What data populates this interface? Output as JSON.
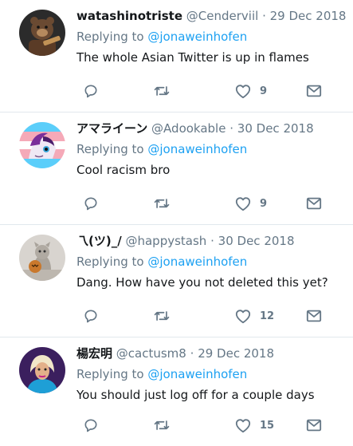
{
  "tweets": [
    {
      "name": "watashinotriste",
      "handle": "@Cenderviil",
      "date": "29 Dec 2018",
      "replying_prefix": "Replying to",
      "replying_to": "@jonaweinhofen",
      "text": "The whole Asian Twitter is up in flames",
      "like_count": "9",
      "avatar_colors": [
        "#2b2b2b",
        "#6a4a32",
        "#b58a5e"
      ]
    },
    {
      "name": "アマライーン",
      "handle": "@Adookable",
      "date": "30 Dec 2018",
      "replying_prefix": "Replying to",
      "replying_to": "@jonaweinhofen",
      "text": "Cool racism bro",
      "like_count": "9",
      "avatar_colors": [
        "#5bcefa",
        "#f5a9b8",
        "#ffffff"
      ]
    },
    {
      "name": "乁(ツ)_/",
      "handle": "@happystash",
      "date": "30 Dec 2018",
      "replying_prefix": "Replying to",
      "replying_to": "@jonaweinhofen",
      "text": "Dang. How have you not deleted this yet?",
      "like_count": "12",
      "avatar_colors": [
        "#d8d4cf",
        "#a9a39b",
        "#c9782c"
      ]
    },
    {
      "name": "楊宏明",
      "handle": "@cactusm8",
      "date": "29 Dec 2018",
      "replying_prefix": "Replying to",
      "replying_to": "@jonaweinhofen",
      "text": "You should just log off for a couple days",
      "like_count": "15",
      "avatar_colors": [
        "#3b1f5e",
        "#e3b08a",
        "#c41e8a"
      ]
    }
  ],
  "separator": "·",
  "icons": {
    "reply": "reply-icon",
    "retweet": "retweet-icon",
    "like": "heart-icon",
    "dm": "envelope-icon"
  },
  "colors": {
    "text": "#14171a",
    "secondary": "#657786",
    "link": "#1da1f2",
    "border": "#e1e8ed"
  }
}
